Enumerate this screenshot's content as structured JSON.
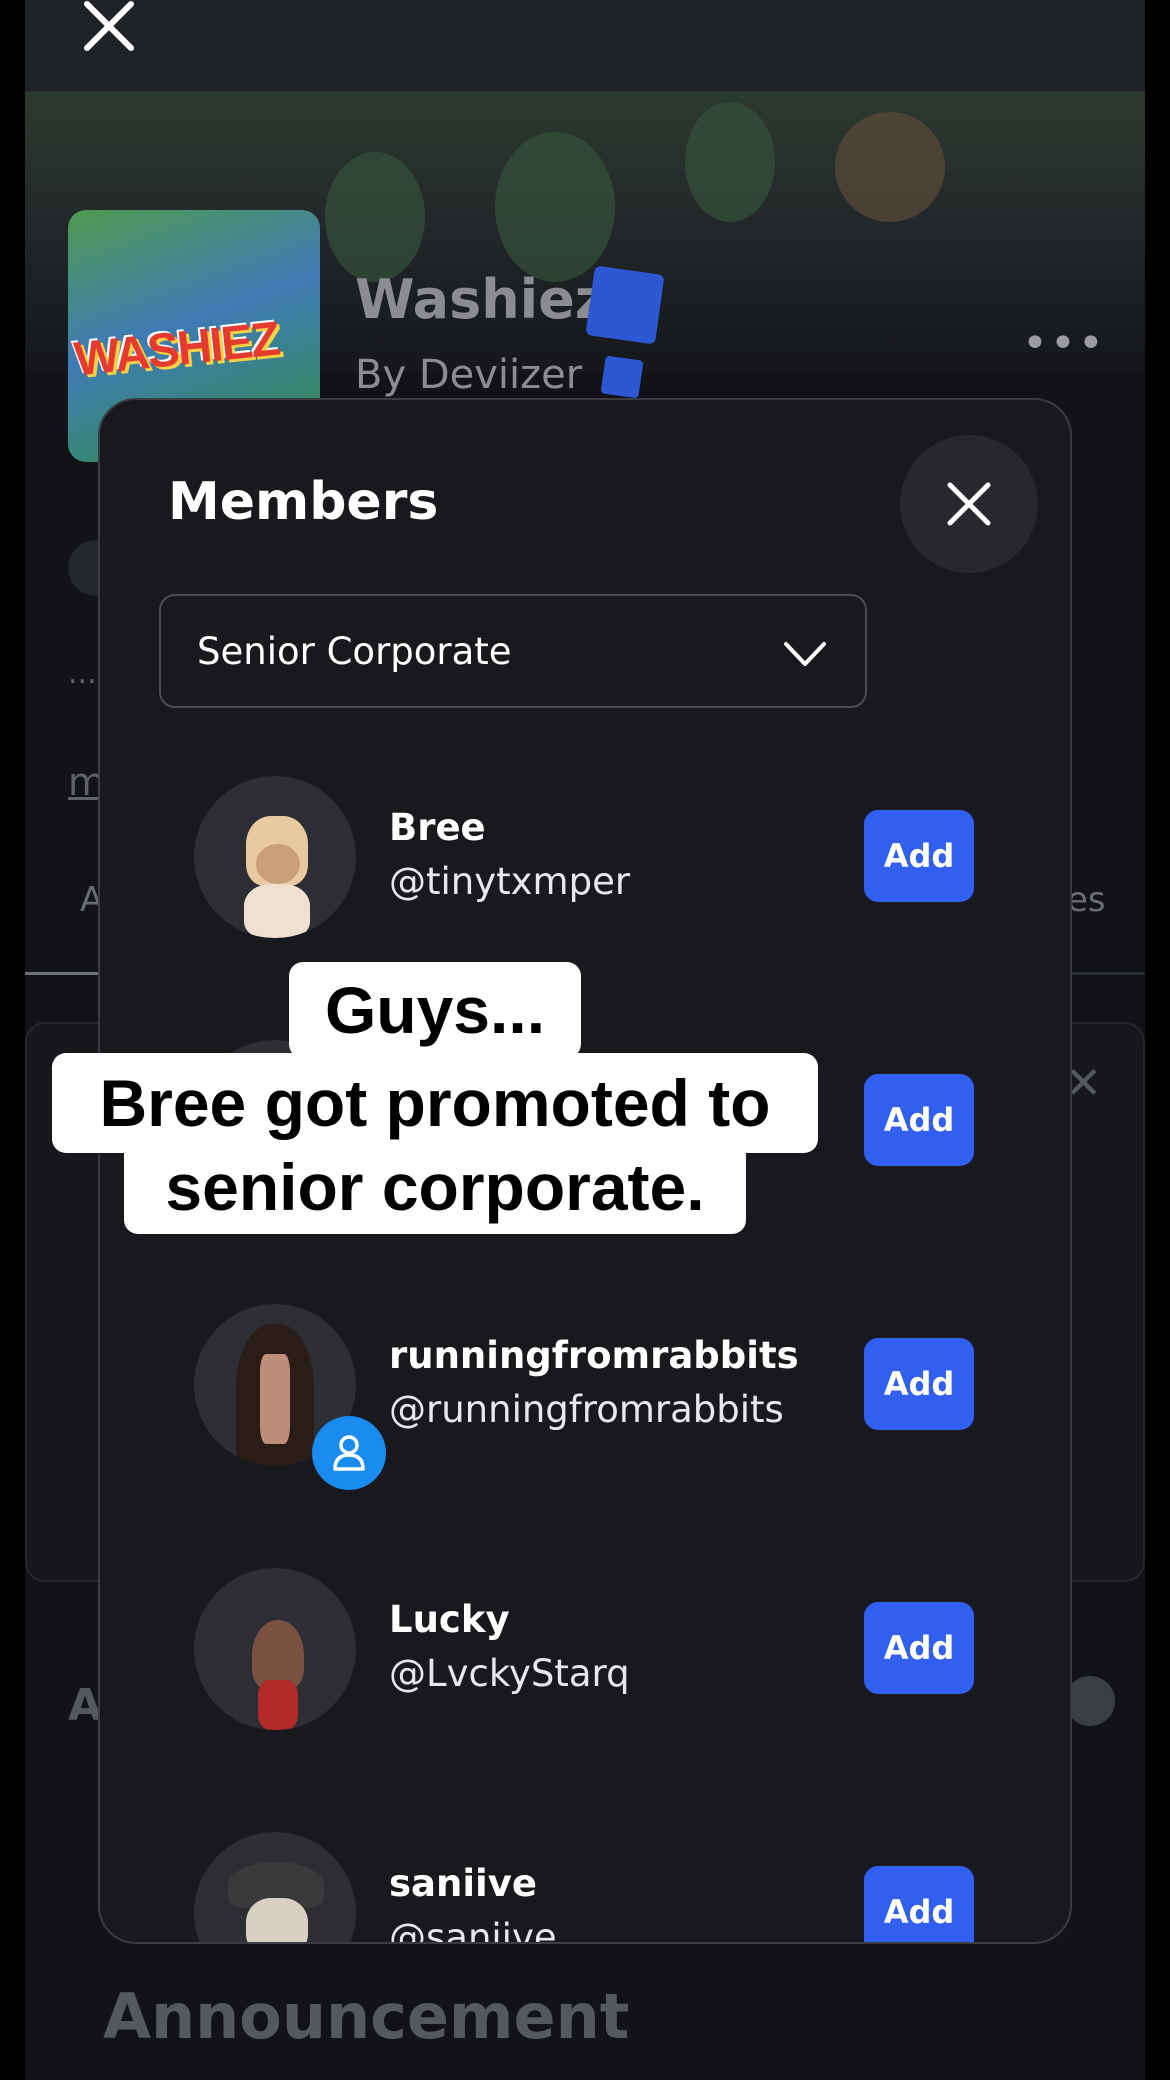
{
  "background": {
    "game_title": "Washiez",
    "game_logo_text": "WASHIEZ",
    "game_by": "By Deviizer",
    "more_label": "•••",
    "left_marks": "...",
    "left_link": "m",
    "tab_left_partial": "A",
    "tab_right_partial": "es",
    "card_close": "✕",
    "section_partial": "A",
    "announcement": "Announcement"
  },
  "modal": {
    "title": "Members",
    "role_select": {
      "value": "Senior Corporate"
    },
    "add_label": "Add",
    "members": [
      {
        "name": "Bree",
        "handle": "@tinytxmper",
        "avatar": "blonde-avatar"
      },
      {
        "name": "",
        "handle": "",
        "avatar": "hidden-avatar"
      },
      {
        "name": "runningfromrabbits",
        "handle": "@runningfromrabbits",
        "avatar": "dark-hair-avatar",
        "badge": "user-icon"
      },
      {
        "name": "Lucky",
        "handle": "@LvckyStarq",
        "avatar": "brown-hair-avatar"
      },
      {
        "name": "saniive",
        "handle": "@saniive",
        "avatar": "hat-avatar"
      }
    ]
  },
  "caption": {
    "line1": "Guys...",
    "line2": "Bree got promoted to",
    "line3": "senior corporate."
  },
  "colors": {
    "accent": "#3160f0",
    "badge": "#1a8cf0",
    "modal_bg": "#18191d"
  }
}
